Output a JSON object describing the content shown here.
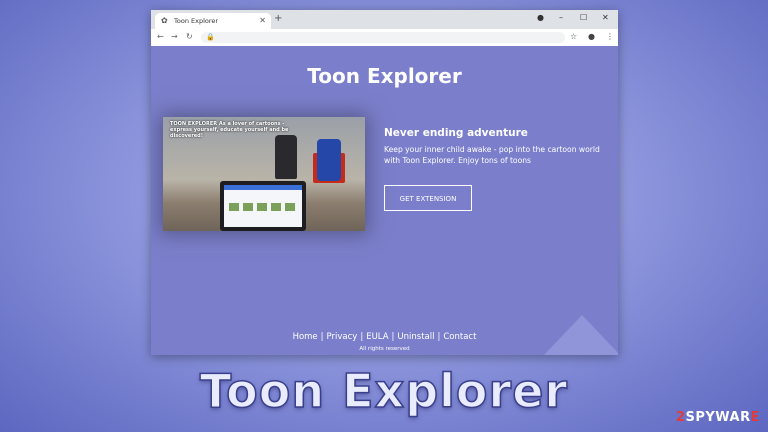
{
  "browser": {
    "tab_title": "Toon Explorer",
    "tab_close": "✕",
    "new_tab": "+",
    "win_min": "–",
    "win_max": "☐",
    "win_close": "✕",
    "icons": [
      "extension-icon",
      "star-icon",
      "profile-icon",
      "menu-icon",
      "back-icon",
      "forward-icon",
      "reload-icon",
      "lock-icon"
    ]
  },
  "page": {
    "title": "Toon Explorer",
    "hero_caption": "TOON EXPLORER As a lover of cartoons - express yourself, educate yourself and be discovered!",
    "headline": "Never ending adventure",
    "body": "Keep your inner child awake - pop into the cartoon world with Toon Explorer. Enjoy tons of toons",
    "cta": "GET EXTENSION",
    "footer": {
      "home": "Home",
      "privacy": "Privacy",
      "eula": "EULA",
      "uninstall": "Uninstall",
      "contact": "Contact",
      "sep": "|",
      "rights": "All rights reserved"
    },
    "bg_color": "#7b7fcb"
  },
  "overlay": {
    "caption": "Toon Explorer",
    "watermark_prefix": "2",
    "watermark_main": "SPYWAR",
    "watermark_suffix": "E"
  }
}
